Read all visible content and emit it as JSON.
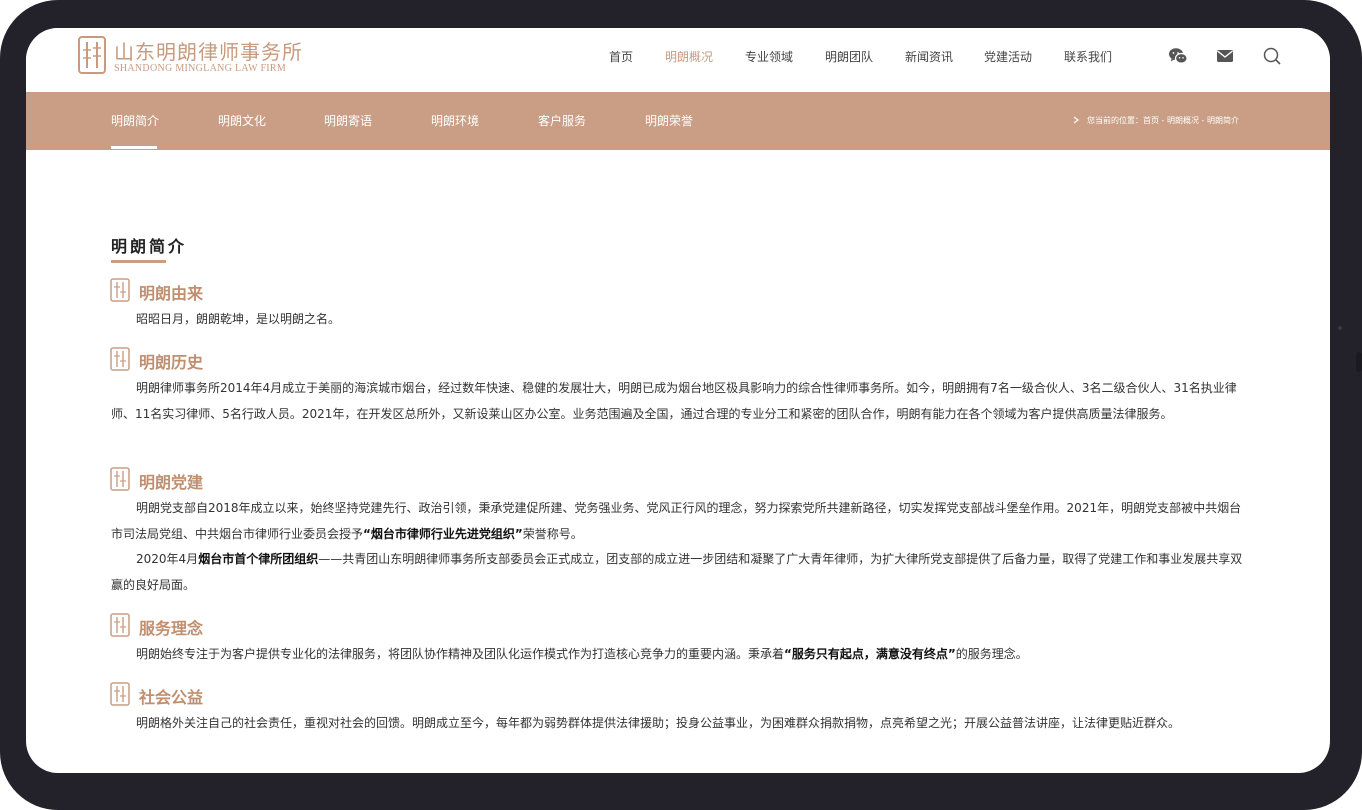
{
  "brand": {
    "name_cn": "山东明朗律师事务所",
    "name_en": "SHANDONG MINGLANG LAW FIRM",
    "accent_color": "#c99e84"
  },
  "nav": {
    "items": [
      "首页",
      "明朗概况",
      "专业领域",
      "明朗团队",
      "新闻资讯",
      "党建活动",
      "联系我们"
    ],
    "active": "明朗概况"
  },
  "header_icons": [
    "wechat-icon",
    "mail-icon",
    "search-icon"
  ],
  "subnav": {
    "items": [
      "明朗简介",
      "明朗文化",
      "明朗寄语",
      "明朗环境",
      "客户服务",
      "明朗荣誉"
    ],
    "active": "明朗简介"
  },
  "breadcrumb": {
    "text": "您当前的位置：首页 - 明朗概况 - 明朗简介"
  },
  "page": {
    "title": "明朗简介"
  },
  "sections": [
    {
      "title": "明朗由来",
      "paragraphs": [
        {
          "parts": [
            "昭昭日月，朗朗乾坤，是以明朗之名。"
          ]
        }
      ]
    },
    {
      "title": "明朗历史",
      "paragraphs": [
        {
          "parts": [
            "明朗律师事务所2014年4月成立于美丽的海滨城市烟台，经过数年快速、稳健的发展壮大，明朗已成为烟台地区极具影响力的综合性律师事务所。如今，明朗拥有7名一级合伙人、3名二级合伙人、31名执业律师、11名实习律师、5名行政人员。2021年，在开发区总所外，又新设莱山区办公室。业务范围遍及全国，通过合理的专业分工和紧密的团队合作，明朗有能力在各个领域为客户提供高质量法律服务。"
          ]
        }
      ]
    },
    {
      "title": "明朗党建",
      "paragraphs": [
        {
          "parts": [
            "明朗党支部自2018年成立以来，始终坚持党建先行、政治引领，秉承党建促所建、党务强业务、党风正行风的理念，努力探索党所共建新路径，切实发挥党支部战斗堡垒作用。2021年，明朗党支部被中共烟台市司法局党组、中共烟台市律师行业委员会授予",
            "“烟台市律师行业先进党组织”",
            "荣誉称号。"
          ]
        },
        {
          "parts": [
            "2020年4月",
            "烟台市首个律所团组织",
            "——共青团山东明朗律师事务所支部委员会正式成立，团支部的成立进一步团结和凝聚了广大青年律师，为扩大律所党支部提供了后备力量，取得了党建工作和事业发展共享双赢的良好局面。"
          ]
        }
      ]
    },
    {
      "title": "服务理念",
      "paragraphs": [
        {
          "parts": [
            "明朗始终专注于为客户提供专业化的法律服务，将团队协作精神及团队化运作模式作为打造核心竞争力的重要内涵。秉承着",
            "“服务只有起点，满意没有终点”",
            "的服务理念。"
          ]
        }
      ]
    },
    {
      "title": "社会公益",
      "paragraphs": [
        {
          "parts": [
            "明朗格外关注自己的社会责任，重视对社会的回馈。明朗成立至今，每年都为弱势群体提供法律援助；投身公益事业，为困难群众捐款捐物，点亮希望之光；开展公益普法讲座，让法律更贴近群众。"
          ]
        }
      ]
    }
  ]
}
